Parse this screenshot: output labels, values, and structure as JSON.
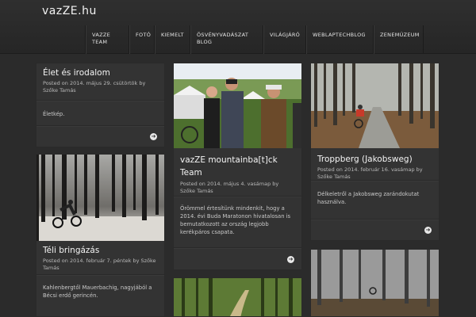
{
  "site": {
    "title": "vazZE.hu"
  },
  "nav": {
    "items": [
      "VAZZE TEAM",
      "FOTÓ",
      "KIEMELT",
      "ÖSVÉNYVADÁSZAT BLOG",
      "VILÁGJÁRÓ",
      "WEBLAPTECHBLOG",
      "ZENEMÚZEUM"
    ]
  },
  "posts": [
    {
      "title": "Élet és irodalom",
      "meta": "Posted on 2014. május 29. csütörtök by Szőke Tamás",
      "excerpt": "Életkép."
    },
    {
      "title": "vazZE mountainba[t]ck Team",
      "meta": "Posted on 2014. május 4. vasámap by Szőke Tamás",
      "excerpt": "Örömmel értesítünk mindenkit, hogy a 2014. évi Buda Maratonon hivatalosan is bemutatkozott az ország legjobb kerékpáros csapata."
    },
    {
      "title": "Troppberg (Jakobsweg)",
      "meta": "Posted on 2014. február 16. vasámap by Szőke Tamás",
      "excerpt": "Délkeletről a Jakobsweg zarándokutat használva."
    },
    {
      "title": "Téli bringázás",
      "meta": "Posted on 2014. február 7. péntek by Szőke Tamás",
      "excerpt": "Kahlenbergtől Mauerbachig, nagyjából a Bécsi erdő gerincén."
    }
  ],
  "icons": {
    "arrow": "arrow-right-circle-icon"
  },
  "colors": {
    "background": "#2b2b2b",
    "card": "#333333",
    "text": "#f4f4f4"
  }
}
